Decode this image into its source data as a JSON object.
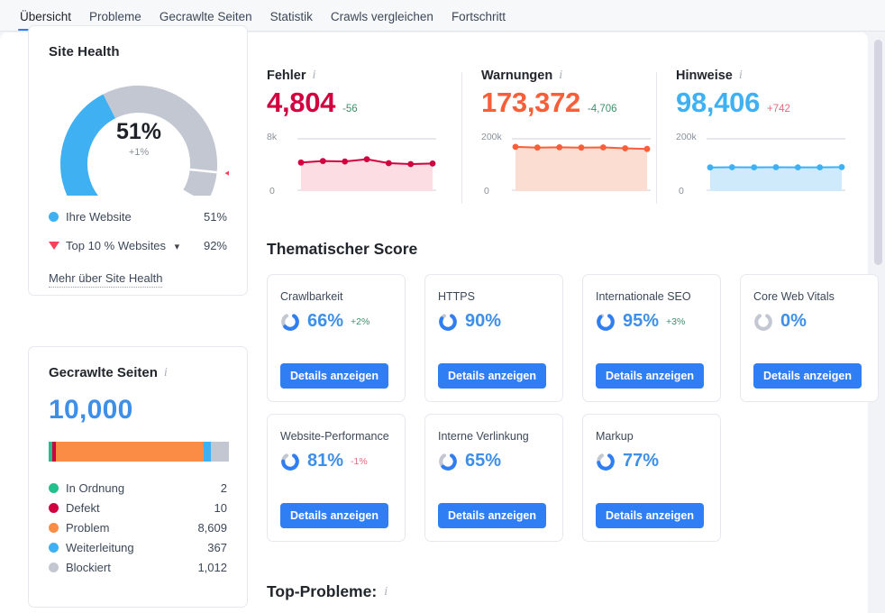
{
  "tabs": [
    {
      "label": "Übersicht",
      "active": true
    },
    {
      "label": "Probleme",
      "active": false
    },
    {
      "label": "Gecrawlte Seiten",
      "active": false
    },
    {
      "label": "Statistik",
      "active": false
    },
    {
      "label": "Crawls vergleichen",
      "active": false
    },
    {
      "label": "Fortschritt",
      "active": false
    }
  ],
  "site_health": {
    "title": "Site Health",
    "score": "51%",
    "delta": "+1%",
    "legend": [
      {
        "label": "Ihre Website",
        "value": "51%",
        "color": "#3fb1f3"
      },
      {
        "label": "Top 10 % Websites",
        "value": "92%",
        "color": "#f8415a"
      }
    ],
    "more_link": "Mehr über Site Health",
    "chart_data": {
      "type": "pie",
      "title": "Site Health",
      "categories": [
        "Ihre Website",
        "Rest"
      ],
      "values": [
        51,
        49
      ],
      "benchmark": 92,
      "unit": "%"
    }
  },
  "crawled_pages": {
    "title": "Gecrawlte Seiten",
    "total": "10,000",
    "legend": [
      {
        "label": "In Ordnung",
        "value": "2",
        "color": "#22c08c",
        "share": 2
      },
      {
        "label": "Defekt",
        "value": "10",
        "color": "#d1003f",
        "share": 10
      },
      {
        "label": "Problem",
        "value": "8,609",
        "color": "#fa8c46",
        "share": 8609
      },
      {
        "label": "Weiterleitung",
        "value": "367",
        "color": "#3fb1f3",
        "share": 367
      },
      {
        "label": "Blockiert",
        "value": "1,012",
        "color": "#c3c7d1",
        "share": 1012
      }
    ],
    "chart_data": {
      "type": "bar",
      "title": "Gecrawlte Seiten",
      "categories": [
        "In Ordnung",
        "Defekt",
        "Problem",
        "Weiterleitung",
        "Blockiert"
      ],
      "values": [
        2,
        10,
        8609,
        367,
        1012
      ],
      "total": 10000
    }
  },
  "metrics": [
    {
      "label": "Fehler",
      "value": "4,804",
      "delta": "-56",
      "delta_sign": "pos",
      "color": "#d1003f",
      "fill": "#fbdde3",
      "axis_top": "8k",
      "axis_bottom": "0",
      "chart_data": {
        "type": "area",
        "title": "Fehler",
        "ylim": [
          0,
          8000
        ],
        "values": [
          4700,
          4950,
          4880,
          5250,
          4600,
          4450,
          4540
        ]
      }
    },
    {
      "label": "Warnungen",
      "value": "173,372",
      "delta": "-4,706",
      "delta_sign": "pos",
      "color": "#f75f3a",
      "fill": "#fcddd2",
      "axis_top": "200k",
      "axis_bottom": "0",
      "chart_data": {
        "type": "area",
        "title": "Warnungen",
        "ylim": [
          0,
          200000
        ],
        "values": [
          182000,
          179000,
          180000,
          179000,
          179500,
          176000,
          173372
        ]
      }
    },
    {
      "label": "Hinweise",
      "value": "98,406",
      "delta": "+742",
      "delta_sign": "neg",
      "color": "#3fb1f3",
      "fill": "#cfeafb",
      "axis_top": "200k",
      "axis_bottom": "0",
      "chart_data": {
        "type": "area",
        "title": "Hinweise",
        "ylim": [
          0,
          200000
        ],
        "values": [
          97500,
          98200,
          97800,
          98100,
          97900,
          97600,
          98406
        ]
      }
    }
  ],
  "thematic_score": {
    "title": "Thematischer Score",
    "button_label": "Details anzeigen",
    "cards": [
      {
        "name": "Crawlbarkeit",
        "value": "66%",
        "pct": 66,
        "delta": "+2%",
        "delta_sign": "pos"
      },
      {
        "name": "HTTPS",
        "value": "90%",
        "pct": 90,
        "delta": "",
        "delta_sign": ""
      },
      {
        "name": "Internationale SEO",
        "value": "95%",
        "pct": 95,
        "delta": "+3%",
        "delta_sign": "pos"
      },
      {
        "name": "Core Web Vitals",
        "value": "0%",
        "pct": 0,
        "delta": "",
        "delta_sign": ""
      },
      {
        "name": "Website-Performance",
        "value": "81%",
        "pct": 81,
        "delta": "-1%",
        "delta_sign": "neg"
      },
      {
        "name": "Interne Verlinkung",
        "value": "65%",
        "pct": 65,
        "delta": "",
        "delta_sign": ""
      },
      {
        "name": "Markup",
        "value": "77%",
        "pct": 77,
        "delta": "",
        "delta_sign": ""
      }
    ],
    "chart_data": {
      "type": "bar",
      "title": "Thematischer Score",
      "categories": [
        "Crawlbarkeit",
        "HTTPS",
        "Internationale SEO",
        "Core Web Vitals",
        "Website-Performance",
        "Interne Verlinkung",
        "Markup"
      ],
      "values": [
        66,
        90,
        95,
        0,
        81,
        65,
        77
      ],
      "ylim": [
        0,
        100
      ],
      "ylabel": "%"
    }
  },
  "top_problems": {
    "title": "Top-Probleme:"
  }
}
